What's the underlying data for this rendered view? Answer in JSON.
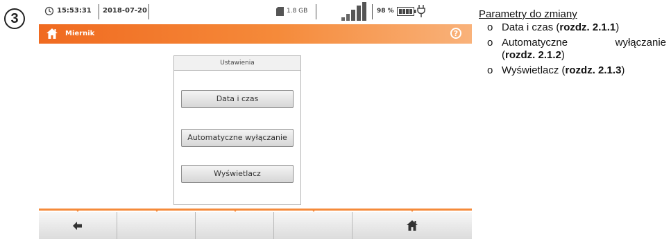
{
  "step_number": "3",
  "status": {
    "time": "15:53:31",
    "date": "2018-07-20",
    "storage": "1.8 GB",
    "battery": "98 %"
  },
  "header": {
    "title": "Miernik",
    "help": "?"
  },
  "panel": {
    "title": "Ustawienia",
    "buttons": [
      "Data i czas",
      "Automatyczne wyłączanie",
      "Wyświetlacz"
    ]
  },
  "bottom_keys": [
    "back-arrow-icon",
    "",
    "",
    "",
    "home-icon"
  ],
  "doc": {
    "heading": "Parametry do zmiany",
    "bullet": "o",
    "items": [
      {
        "text": "Data i czas (",
        "bold": "rozdz. 2.1.1",
        "end": ")"
      },
      {
        "text_a": "Automatyczne",
        "text_b": "wyłączanie",
        "open": "(",
        "bold": "rozdz. 2.1.2",
        "end": ")"
      },
      {
        "text": "Wyświetlacz (",
        "bold": "rozdz. 2.1.3",
        "end": ")"
      }
    ]
  },
  "colors": {
    "accent": "#f58a3a",
    "accent_dark": "#f06a20"
  }
}
